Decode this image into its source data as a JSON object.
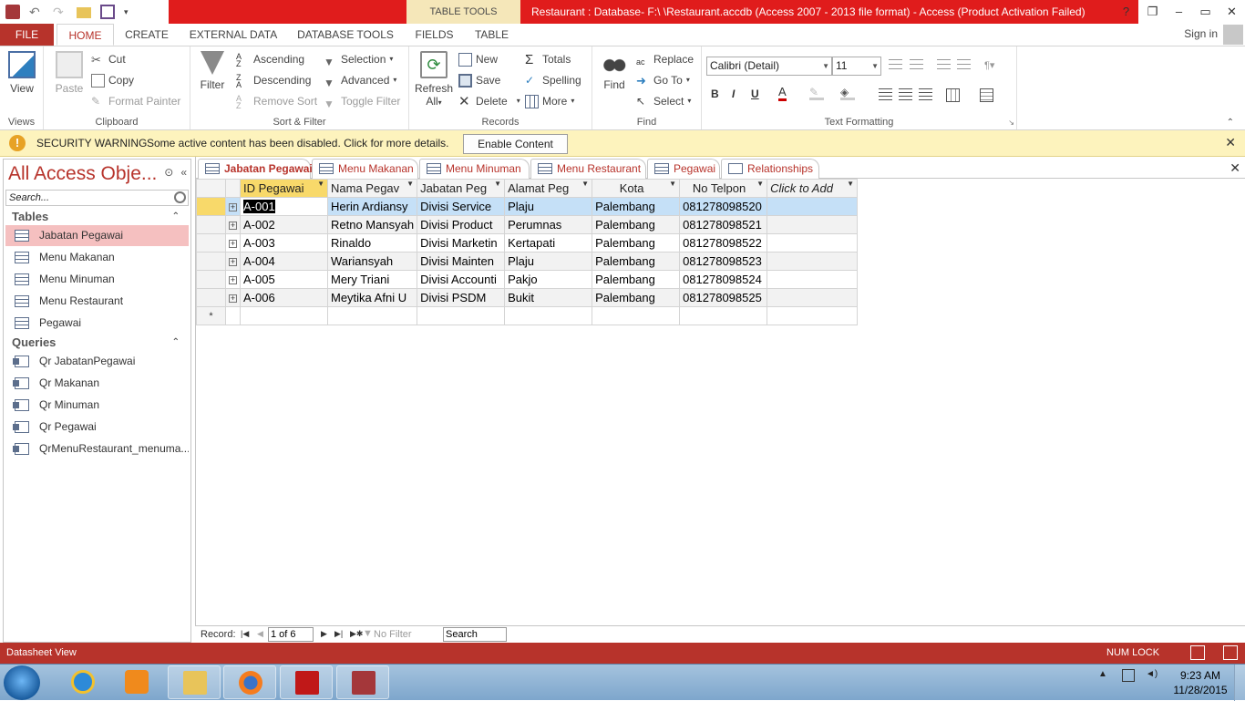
{
  "window": {
    "title": "Restaurant : Database- F:\\ \\Restaurant.accdb (Access 2007 - 2013 file format) -  Access (Product Activation Failed)",
    "context_tab": "TABLE TOOLS",
    "controls": {
      "help": "?",
      "restore": "❐",
      "minimize": "–",
      "maximize": "▭",
      "close": "✕"
    }
  },
  "ribbon_tabs": {
    "file": "FILE",
    "home": "HOME",
    "create": "CREATE",
    "external": "EXTERNAL DATA",
    "dbtools": "DATABASE TOOLS",
    "fields": "FIELDS",
    "table": "TABLE",
    "sign_in": "Sign in"
  },
  "ribbon": {
    "views": {
      "view": "View",
      "label": "Views"
    },
    "clipboard": {
      "paste": "Paste",
      "cut": "Cut",
      "copy": "Copy",
      "format_painter": "Format Painter",
      "label": "Clipboard"
    },
    "sort_filter": {
      "filter": "Filter",
      "ascending": "Ascending",
      "descending": "Descending",
      "remove_sort": "Remove Sort",
      "selection": "Selection",
      "advanced": "Advanced",
      "toggle_filter": "Toggle Filter",
      "label": "Sort & Filter"
    },
    "records": {
      "refresh_all_1": "Refresh",
      "refresh_all_2": "All",
      "new": "New",
      "save": "Save",
      "delete": "Delete",
      "totals": "Totals",
      "spelling": "Spelling",
      "more": "More",
      "label": "Records"
    },
    "find": {
      "find": "Find",
      "replace": "Replace",
      "goto": "Go To",
      "select": "Select",
      "label": "Find"
    },
    "text_formatting": {
      "font": "Calibri (Detail)",
      "size": "11",
      "bold": "B",
      "italic": "I",
      "underline": "U",
      "label": "Text Formatting"
    }
  },
  "security_bar": {
    "title": "SECURITY WARNING",
    "message": "Some active content has been disabled. Click for more details.",
    "enable_button": "Enable Content",
    "icon": "!",
    "close": "✕"
  },
  "nav_pane": {
    "title": "All Access Obje...",
    "search_placeholder": "Search...",
    "tables_header": "Tables",
    "tables": [
      "Jabatan Pegawai",
      "Menu Makanan",
      "Menu Minuman",
      "Menu Restaurant",
      "Pegawai"
    ],
    "queries_header": "Queries",
    "queries": [
      "Qr JabatanPegawai",
      "Qr Makanan",
      "Qr Minuman",
      "Qr Pegawai",
      "QrMenuRestaurant_menuma..."
    ]
  },
  "doc_tabs": [
    "Jabatan Pegawai",
    "Menu Makanan",
    "Menu Minuman",
    "Menu Restaurant",
    "Pegawai",
    "Relationships"
  ],
  "datasheet": {
    "columns": [
      "ID Pegawai",
      "Nama Pegav",
      "Jabatan Peg",
      "Alamat Peg",
      "Kota",
      "No Telpon",
      "Click to Add"
    ],
    "rows": [
      [
        "A-001",
        "Herin Ardiansy",
        "Divisi Service",
        "Plaju",
        "Palembang",
        "081278098520"
      ],
      [
        "A-002",
        "Retno Mansyah",
        "Divisi Product",
        "Perumnas",
        "Palembang",
        "081278098521"
      ],
      [
        "A-003",
        "Rinaldo",
        "Divisi Marketin",
        "Kertapati",
        "Palembang",
        "081278098522"
      ],
      [
        "A-004",
        "Wariansyah",
        "Divisi Mainten",
        "Plaju",
        "Palembang",
        "081278098523"
      ],
      [
        "A-005",
        "Mery Triani",
        "Divisi Accounti",
        "Pakjo",
        "Palembang",
        "081278098524"
      ],
      [
        "A-006",
        "Meytika Afni U",
        "Divisi PSDM",
        "Bukit",
        "Palembang",
        "081278098525"
      ]
    ],
    "new_row_marker": "*"
  },
  "record_nav": {
    "label": "Record:",
    "position": "1 of 6",
    "no_filter": "No Filter",
    "search": "Search"
  },
  "status_bar": {
    "left": "Datasheet View",
    "num_lock": "NUM LOCK"
  },
  "taskbar": {
    "time": "9:23 AM",
    "date": "11/28/2015"
  }
}
